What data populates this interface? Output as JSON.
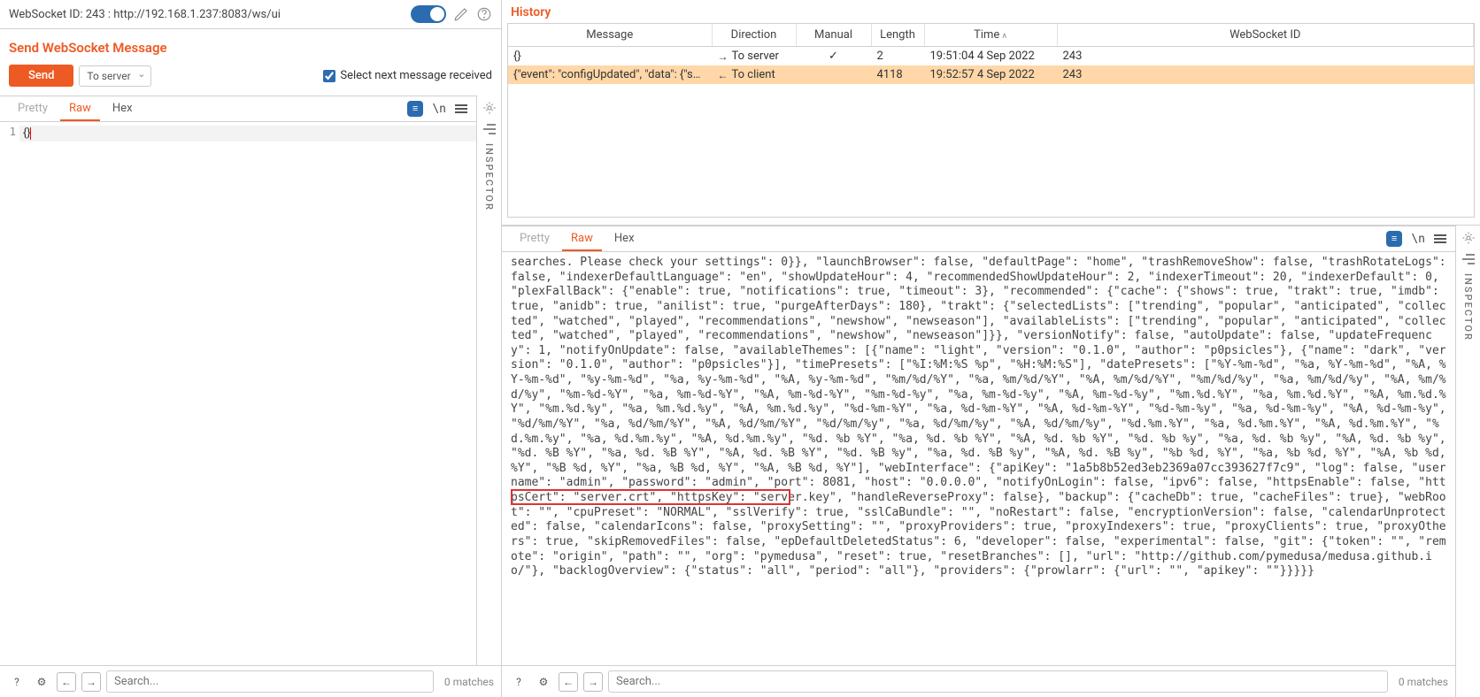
{
  "header": {
    "ws_id_label": "WebSocket ID: 243 : http://192.168.1.237:8083/ws/ui"
  },
  "send": {
    "title": "Send WebSocket Message",
    "button": "Send",
    "direction": "To server",
    "checkbox_label": "Select next message received"
  },
  "left_tabs": {
    "pretty": "Pretty",
    "raw": "Raw",
    "hex": "Hex",
    "active": "Raw"
  },
  "editor": {
    "gutter": "1",
    "content": "{}"
  },
  "footer": {
    "help": "?",
    "settings": "⚙",
    "back": "←",
    "forward": "→",
    "search_placeholder": "Search...",
    "matches": "0 matches"
  },
  "history": {
    "title": "History",
    "columns": {
      "message": "Message",
      "direction": "Direction",
      "manual": "Manual",
      "length": "Length",
      "time": "Time",
      "wsid": "WebSocket ID"
    },
    "rows": [
      {
        "message": "{}",
        "direction": "To server",
        "dir_arrow": "→",
        "manual": "✓",
        "length": "2",
        "time": "19:51:04 4 Sep 2022",
        "wsid": "243",
        "selected": false
      },
      {
        "message": "{\"event\": \"configUpdated\", \"data\": {\"s…",
        "direction": "To client",
        "dir_arrow": "←",
        "manual": "",
        "length": "4118",
        "time": "19:52:57 4 Sep 2022",
        "wsid": "243",
        "selected": true
      }
    ]
  },
  "right_tabs": {
    "pretty": "Pretty",
    "raw": "Raw",
    "hex": "Hex",
    "active": "Raw"
  },
  "raw_content": "searches. Please check your settings\": 0}}, \"launchBrowser\": false, \"defaultPage\": \"home\", \"trashRemoveShow\": false, \"trashRotateLogs\": false, \"indexerDefaultLanguage\": \"en\", \"showUpdateHour\": 4, \"recommendedShowUpdateHour\": 2, \"indexerTimeout\": 20, \"indexerDefault\": 0, \"plexFallBack\": {\"enable\": true, \"notifications\": true, \"timeout\": 3}, \"recommended\": {\"cache\": {\"shows\": true, \"trakt\": true, \"imdb\": true, \"anidb\": true, \"anilist\": true, \"purgeAfterDays\": 180}, \"trakt\": {\"selectedLists\": [\"trending\", \"popular\", \"anticipated\", \"collected\", \"watched\", \"played\", \"recommendations\", \"newshow\", \"newseason\"], \"availableLists\": [\"trending\", \"popular\", \"anticipated\", \"collected\", \"watched\", \"played\", \"recommendations\", \"newshow\", \"newseason\"]}}, \"versionNotify\": false, \"autoUpdate\": false, \"updateFrequency\": 1, \"notifyOnUpdate\": false, \"availableThemes\": [{\"name\": \"light\", \"version\": \"0.1.0\", \"author\": \"p0psicles\"}, {\"name\": \"dark\", \"version\": \"0.1.0\", \"author\": \"p0psicles\"}], \"timePresets\": [\"%I:%M:%S %p\", \"%H:%M:%S\"], \"datePresets\": [\"%Y-%m-%d\", \"%a, %Y-%m-%d\", \"%A, %Y-%m-%d\", \"%y-%m-%d\", \"%a, %y-%m-%d\", \"%A, %y-%m-%d\", \"%m/%d/%Y\", \"%a, %m/%d/%Y\", \"%A, %m/%d/%Y\", \"%m/%d/%y\", \"%a, %m/%d/%y\", \"%A, %m/%d/%y\", \"%m-%d-%Y\", \"%a, %m-%d-%Y\", \"%A, %m-%d-%Y\", \"%m-%d-%y\", \"%a, %m-%d-%y\", \"%A, %m-%d-%y\", \"%m.%d.%Y\", \"%a, %m.%d.%Y\", \"%A, %m.%d.%Y\", \"%m.%d.%y\", \"%a, %m.%d.%y\", \"%A, %m.%d.%y\", \"%d-%m-%Y\", \"%a, %d-%m-%Y\", \"%A, %d-%m-%Y\", \"%d-%m-%y\", \"%a, %d-%m-%y\", \"%A, %d-%m-%y\", \"%d/%m/%Y\", \"%a, %d/%m/%Y\", \"%A, %d/%m/%Y\", \"%d/%m/%y\", \"%a, %d/%m/%y\", \"%A, %d/%m/%y\", \"%d.%m.%Y\", \"%a, %d.%m.%Y\", \"%A, %d.%m.%Y\", \"%d.%m.%y\", \"%a, %d.%m.%y\", \"%A, %d.%m.%y\", \"%d. %b %Y\", \"%a, %d. %b %Y\", \"%A, %d. %b %Y\", \"%d. %b %y\", \"%a, %d. %b %y\", \"%A, %d. %b %y\", \"%d. %B %Y\", \"%a, %d. %B %Y\", \"%A, %d. %B %Y\", \"%d. %B %y\", \"%a, %d. %B %y\", \"%A, %d. %B %y\", \"%b %d, %Y\", \"%a, %b %d, %Y\", \"%A, %b %d, %Y\", \"%B %d, %Y\", \"%a, %B %d, %Y\", \"%A, %B %d, %Y\"], \"webInterface\": {\"apiKey\": \"1a5b8b52ed3eb2369a07cc393627f7c9\", \"log\": false, \"username\": \"admin\", \"password\": \"admin\", \"port\": 8081, \"host\": \"0.0.0.0\", \"notifyOnLogin\": false, \"ipv6\": false, \"httpsEnable\": false, \"httpsCert\": \"server.crt\", \"httpsKey\": \"server.key\", \"handleReverseProxy\": false}, \"backup\": {\"cacheDb\": true, \"cacheFiles\": true}, \"webRoot\": \"\", \"cpuPreset\": \"NORMAL\", \"sslVerify\": true, \"sslCaBundle\": \"\", \"noRestart\": false, \"encryptionVersion\": false, \"calendarUnprotected\": false, \"calendarIcons\": false, \"proxySetting\": \"\", \"proxyProviders\": true, \"proxyIndexers\": true, \"proxyClients\": true, \"proxyOthers\": true, \"skipRemovedFiles\": false, \"epDefaultDeletedStatus\": 6, \"developer\": false, \"experimental\": false, \"git\": {\"token\": \"\", \"remote\": \"origin\", \"path\": \"\", \"org\": \"pymedusa\", \"reset\": true, \"resetBranches\": [], \"url\": \"http://github.com/pymedusa/medusa.github.io/\"}, \"backlogOverview\": {\"status\": \"all\", \"period\": \"all\"}, \"providers\": {\"prowlarr\": {\"url\": \"\", \"apikey\": \"\"}}}}}",
  "highlighted_credentials": "\"username\": \"admin\", \"password\": \"admin\"",
  "inspector_label": "INSPECTOR"
}
